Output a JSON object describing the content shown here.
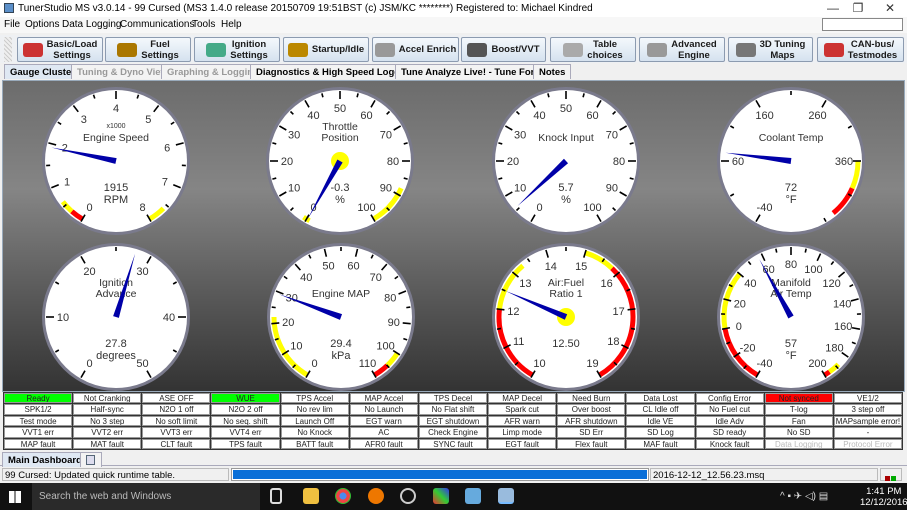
{
  "title": "TunerStudio MS v3.0.14 - 99 Cursed (MS3 1.4.0 release   20150709 19:51BST (c) JSM/KC ********) Registered to: Michael Kindred",
  "window_controls": {
    "minimize": "—",
    "restore": "❐",
    "close": "✕"
  },
  "menu": [
    "File",
    "Options",
    "Data Logging",
    "Communications",
    "Tools",
    "Help"
  ],
  "toolbar": [
    {
      "l1": "Basic/Load",
      "l2": "Settings",
      "icon": "tools-icon",
      "color": "#c33"
    },
    {
      "l1": "Fuel",
      "l2": "Settings",
      "icon": "injector-icon",
      "color": "#a70"
    },
    {
      "l1": "Ignition",
      "l2": "Settings",
      "icon": "spark-plug-icon",
      "color": "#4a8"
    },
    {
      "l1": "Startup/Idle",
      "l2": "",
      "icon": "hammer-icon",
      "color": "#b80"
    },
    {
      "l1": "Accel Enrich",
      "l2": "",
      "icon": "gear-icon",
      "color": "#999"
    },
    {
      "l1": "Boost/VVT",
      "l2": "",
      "icon": "turbo-icon",
      "color": "#555"
    },
    {
      "l1": "Table",
      "l2": "choices",
      "icon": "wrench-icon",
      "color": "#aaa"
    },
    {
      "l1": "Advanced",
      "l2": "Engine",
      "icon": "gears-icon",
      "color": "#999"
    },
    {
      "l1": "3D Tuning",
      "l2": "Maps",
      "icon": "tuning-icon",
      "color": "#777"
    },
    {
      "l1": "CAN-bus/",
      "l2": "Testmodes",
      "icon": "tools-icon",
      "color": "#c33"
    }
  ],
  "tabs": [
    {
      "label": "Gauge Cluster",
      "state": "active"
    },
    {
      "label": "Tuning & Dyno Views",
      "state": "dis"
    },
    {
      "label": "Graphing & Logging",
      "state": "dis"
    },
    {
      "label": "Diagnostics & High Speed Loggers",
      "state": ""
    },
    {
      "label": "Tune Analyze Live! - Tune For You",
      "state": ""
    },
    {
      "label": "Notes",
      "state": ""
    }
  ],
  "gauges": [
    {
      "id": "engine-speed",
      "title": [
        "x1000",
        "Engine Speed"
      ],
      "min": 0,
      "max": 8,
      "labels": [
        0,
        1,
        2,
        3,
        4,
        5,
        6,
        7,
        8
      ],
      "minor": 0.5,
      "value": 1.915,
      "value_text": "1915",
      "units": "RPM",
      "hub": false,
      "zones": [
        {
          "from": 0,
          "to": 0.3,
          "color": "#f00"
        },
        {
          "from": 0.3,
          "to": 0.6,
          "color": "#ff0"
        },
        {
          "from": 7.6,
          "to": 8,
          "color": "#ff0"
        }
      ]
    },
    {
      "id": "throttle-position",
      "title": [
        "Throttle",
        "Position"
      ],
      "min": 0,
      "max": 100,
      "labels": [
        0,
        10,
        20,
        30,
        40,
        50,
        60,
        70,
        80,
        90,
        100
      ],
      "minor": 5,
      "value": -0.3,
      "value_text": "-0.3",
      "units": "%",
      "hub": true,
      "zones": [
        {
          "from": -1,
          "to": 1,
          "color": "#ff0"
        },
        {
          "from": 88,
          "to": 100,
          "color": "#ff0"
        }
      ]
    },
    {
      "id": "knock-input",
      "title": [
        "Knock Input"
      ],
      "min": 0,
      "max": 100,
      "labels": [
        0,
        10,
        20,
        30,
        40,
        50,
        60,
        70,
        80,
        90,
        100
      ],
      "minor": 5,
      "value": 5.7,
      "value_text": "5.7",
      "units": "%",
      "hub": false,
      "zones": []
    },
    {
      "id": "coolant-temp",
      "title": [
        "Coolant Temp"
      ],
      "min": -40,
      "max": 460,
      "labels": [
        -40,
        60,
        160,
        260,
        360
      ],
      "minor": 50,
      "value": 72,
      "value_text": "72",
      "units": "°F",
      "hub": false,
      "zones": [
        {
          "from": 360,
          "to": 400,
          "color": "#ff0"
        },
        {
          "from": 400,
          "to": 445,
          "color": "#f00"
        }
      ]
    },
    {
      "id": "ignition-advance",
      "title": [
        "Ignition",
        "Advance"
      ],
      "min": 0,
      "max": 50,
      "labels": [
        0,
        10,
        20,
        30,
        40,
        50
      ],
      "minor": 5,
      "value": 27.8,
      "value_text": "27.8",
      "units": "degrees",
      "hub": false,
      "zones": []
    },
    {
      "id": "engine-map",
      "title": [
        "Engine MAP"
      ],
      "min": 0,
      "max": 110,
      "labels": [
        0,
        10,
        20,
        30,
        40,
        50,
        60,
        70,
        80,
        90,
        100,
        110
      ],
      "minor": 5,
      "value": 29.4,
      "value_text": "29.4",
      "units": "kPa",
      "hub": false,
      "zones": [
        {
          "from": 0,
          "to": 22,
          "color": "#ff0"
        },
        {
          "from": 100,
          "to": 105,
          "color": "#ff0"
        },
        {
          "from": 105,
          "to": 110,
          "color": "#f00"
        }
      ]
    },
    {
      "id": "air-fuel-ratio",
      "title": [
        "Air:Fuel",
        "Ratio 1"
      ],
      "min": 10,
      "max": 19,
      "labels": [
        10,
        11,
        12,
        13,
        14,
        15,
        16,
        17,
        18,
        19
      ],
      "minor": 0.5,
      "value": 12.5,
      "value_text": "12.50",
      "units": "",
      "hub": true,
      "zones": [
        {
          "from": 10,
          "to": 12,
          "color": "#f00"
        },
        {
          "from": 12,
          "to": 13.3,
          "color": "#ff0"
        },
        {
          "from": 15,
          "to": 15.8,
          "color": "#ff0"
        },
        {
          "from": 15.8,
          "to": 19,
          "color": "#f00"
        }
      ]
    },
    {
      "id": "manifold-air-temp",
      "title": [
        "Manifold",
        "Air Temp"
      ],
      "min": -40,
      "max": 200,
      "labels": [
        -40,
        -20,
        0,
        20,
        40,
        60,
        80,
        100,
        120,
        140,
        160,
        180,
        200
      ],
      "minor": 10,
      "value": 57,
      "value_text": "57",
      "units": "°F",
      "hub": false,
      "zones": [
        {
          "from": -40,
          "to": 0,
          "color": "#f00"
        },
        {
          "from": 0,
          "to": 40,
          "color": "#ff0"
        },
        {
          "from": 188,
          "to": 196,
          "color": "#ff0"
        },
        {
          "from": 196,
          "to": 200,
          "color": "#f00"
        }
      ]
    }
  ],
  "indicators": [
    [
      "Ready",
      "Not Cranking",
      "ASE OFF",
      "WUE",
      "TPS Accel",
      "MAP Accel",
      "TPS Decel",
      "MAP Decel",
      "Need Burn",
      "Data Lost",
      "Config Error",
      "Not synced",
      "VE1/2"
    ],
    [
      "SPK1/2",
      "Half-sync",
      "N2O 1 off",
      "N2O 2 off",
      "No rev lim",
      "No Launch",
      "No Flat shift",
      "Spark cut",
      "Over boost",
      "CL Idle off",
      "No Fuel cut",
      "T-log",
      "3 step off"
    ],
    [
      "Test mode",
      "No 3 step",
      "No soft limit",
      "No seq. shift",
      "Launch Off",
      "EGT warn",
      "EGT shutdown",
      "AFR warn",
      "AFR shutdown",
      "Idle VE",
      "Idle Adv",
      "Fan",
      "MAPsample error!"
    ],
    [
      "VVT1 err",
      "VVT2 err",
      "VVT3 err",
      "VVT4 err",
      "No Knock",
      "AC",
      "Check Engine",
      "Limp mode",
      "SD Err",
      "SD Log",
      "SD ready",
      "No SD",
      "-"
    ],
    [
      "MAP fault",
      "MAT fault",
      "CLT fault",
      "TPS fault",
      "BATT fault",
      "AFR0 fault",
      "SYNC fault",
      "EGT fault",
      "Flex fault",
      "MAF fault",
      "Knock fault",
      "Data Logging",
      "Protocol Error"
    ]
  ],
  "indicator_colors": {
    "Ready": "#00ff00",
    "WUE": "#00ff00",
    "Not synced": "#ff0000",
    "Data Logging": "disabled",
    "Protocol Error": "disabled"
  },
  "bottom_tab": "Main Dashboard",
  "status": {
    "message": "99 Cursed: Updated quick runtime table.",
    "progress": 1.0,
    "file": "2016-12-12_12.56.23.msq"
  },
  "taskbar": {
    "search": "Search the web and Windows",
    "time": "1:41 PM",
    "date": "12/12/2016"
  }
}
